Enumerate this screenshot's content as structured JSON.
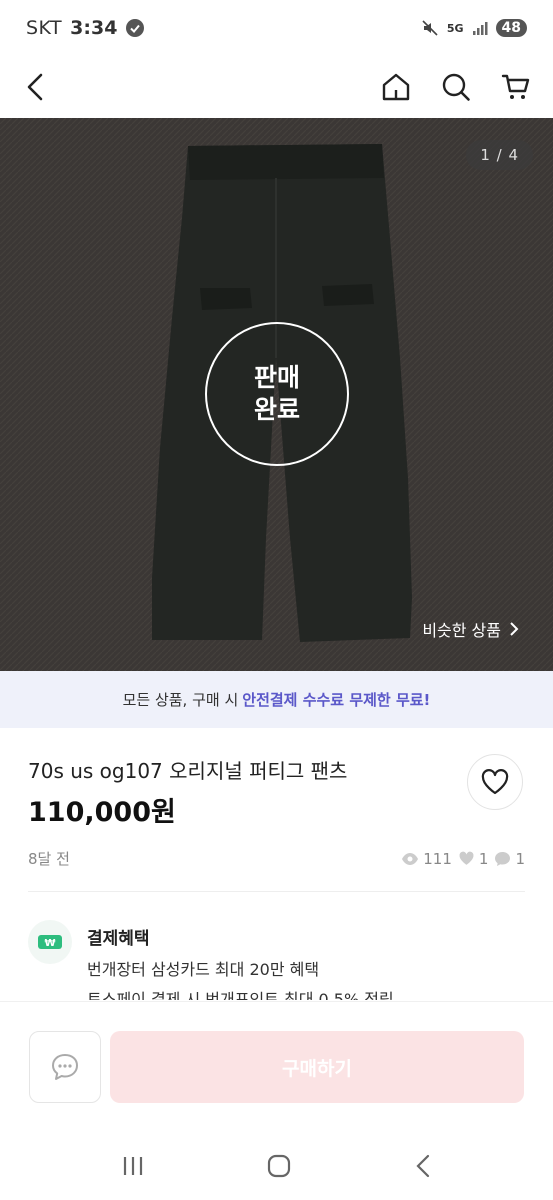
{
  "status_bar": {
    "carrier": "SKT",
    "time": "3:34",
    "network": "5G",
    "battery": "48"
  },
  "header": {
    "back_icon": "back-arrow-icon",
    "home_icon": "home-icon",
    "search_icon": "search-icon",
    "cart_icon": "cart-icon"
  },
  "product_image": {
    "page_indicator": "1 / 4",
    "sold_line1": "판매",
    "sold_line2": "완료",
    "similar_link": "비슷한 상품"
  },
  "promo": {
    "prefix": "모든 상품, 구매 시",
    "highlight": "안전결제 수수료 무제한 무료!",
    "highlight_color": "#5b58c9"
  },
  "product": {
    "title": "70s us og107 오리지널 퍼티그 팬츠",
    "price": "110,000원",
    "time_ago": "8달 전",
    "views": "111",
    "likes": "1",
    "chats": "1"
  },
  "benefits": {
    "title": "결제혜택",
    "line1": "번개장터 삼성카드 최대 20만 혜택",
    "line2": "토스페이 결제 시 번개포인트 최대 0.5% 적립"
  },
  "bottom_bar": {
    "buy_label": "구매하기",
    "buy_bg_color": "#fbe3e4"
  }
}
